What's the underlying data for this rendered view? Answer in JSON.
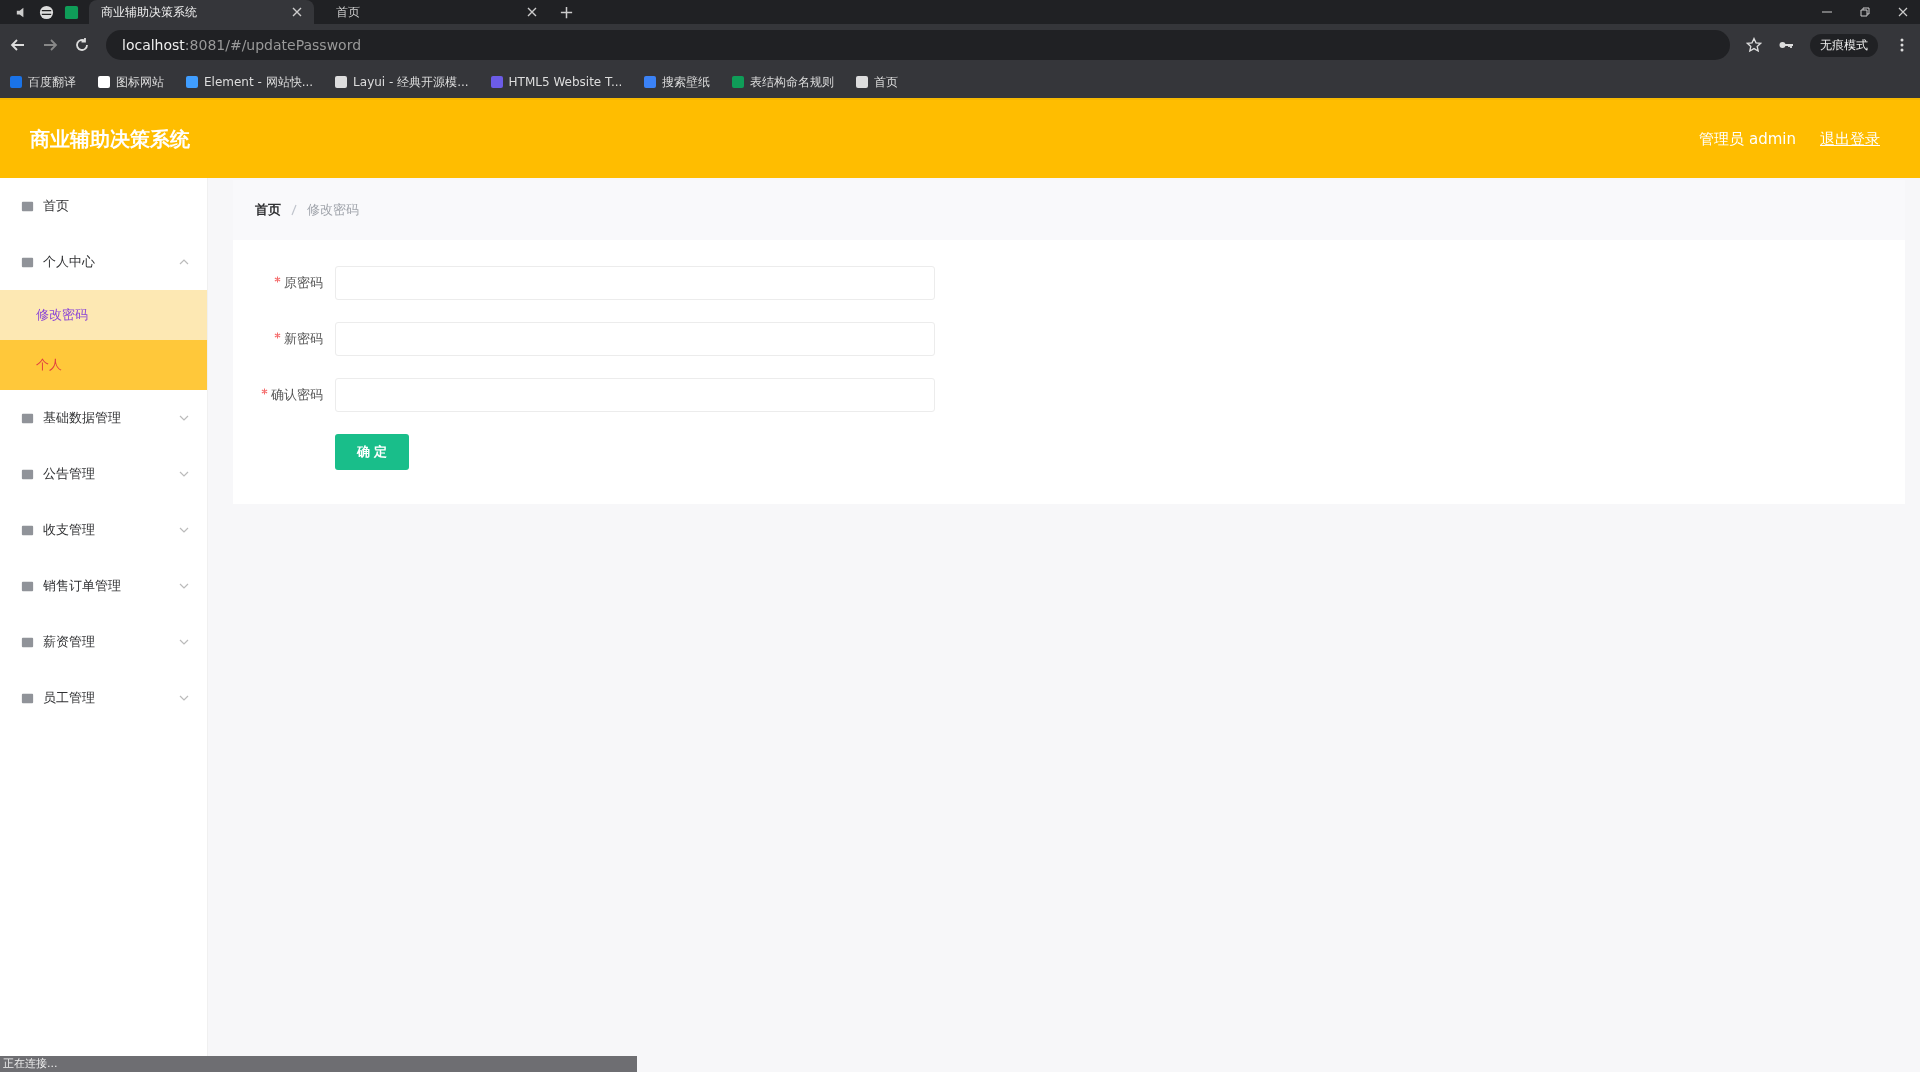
{
  "browser": {
    "tabs": [
      {
        "title": "商业辅助决策系统",
        "selected": true
      },
      {
        "title": "首页",
        "selected": false
      }
    ],
    "address": {
      "host": "localhost",
      "rest": ":8081/#/updatePassword"
    },
    "profile": "无痕模式",
    "bookmarks": [
      "百度翻译",
      "图标网站",
      "Element - 网站快...",
      "Layui - 经典开源模...",
      "HTML5 Website T...",
      "搜索壁纸",
      "表结构命名规则",
      "首页"
    ]
  },
  "header": {
    "title": "商业辅助决策系统",
    "user": "管理员 admin",
    "logout": "退出登录"
  },
  "sidebar": {
    "items": [
      {
        "label": "首页"
      },
      {
        "label": "个人中心",
        "expanded": true,
        "children": [
          {
            "label": "修改密码",
            "selected": true,
            "hovered": false
          },
          {
            "label": "个人",
            "selected": false,
            "hovered": true
          }
        ]
      },
      {
        "label": "基础数据管理",
        "expanded": false
      },
      {
        "label": "公告管理",
        "expanded": false
      },
      {
        "label": "收支管理",
        "expanded": false
      },
      {
        "label": "销售订单管理",
        "expanded": false
      },
      {
        "label": "薪资管理",
        "expanded": false
      },
      {
        "label": "员工管理",
        "expanded": false
      }
    ]
  },
  "breadcrumb": [
    {
      "label": "首页"
    },
    {
      "label": "修改密码"
    }
  ],
  "form": {
    "fields": [
      {
        "label": "原密码",
        "required": true
      },
      {
        "label": "新密码",
        "required": true
      },
      {
        "label": "确认密码",
        "required": true
      }
    ],
    "submit": "确 定"
  },
  "status_bar": "正在连接..."
}
